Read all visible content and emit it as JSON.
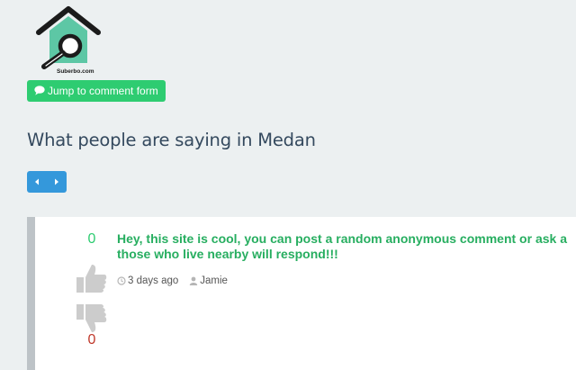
{
  "logo": {
    "text": "Suberbo.com"
  },
  "header": {
    "jump_label": "Jump to comment form"
  },
  "page": {
    "title": "What people are saying in Medan"
  },
  "comment": {
    "upvotes": "0",
    "downvotes": "0",
    "text_line1": "Hey, this site is cool, you can post a random anonymous comment or ask a",
    "text_line2": "those who live nearby will respond!!!",
    "time": "3 days ago",
    "author": "Jamie"
  },
  "colors": {
    "background": "#ecf0f1",
    "green": "#2ecc71",
    "blue": "#3498db",
    "red": "#c0392b",
    "comment_green": "#27ae60",
    "title": "#34495e"
  },
  "icons": {
    "logo": "house-magnifier-icon",
    "jump": "comment-bubble-icon",
    "prev": "caret-left-icon",
    "next": "caret-right-icon",
    "upvote": "thumbs-up-icon",
    "downvote": "thumbs-down-icon",
    "time": "clock-icon",
    "author": "user-icon"
  }
}
